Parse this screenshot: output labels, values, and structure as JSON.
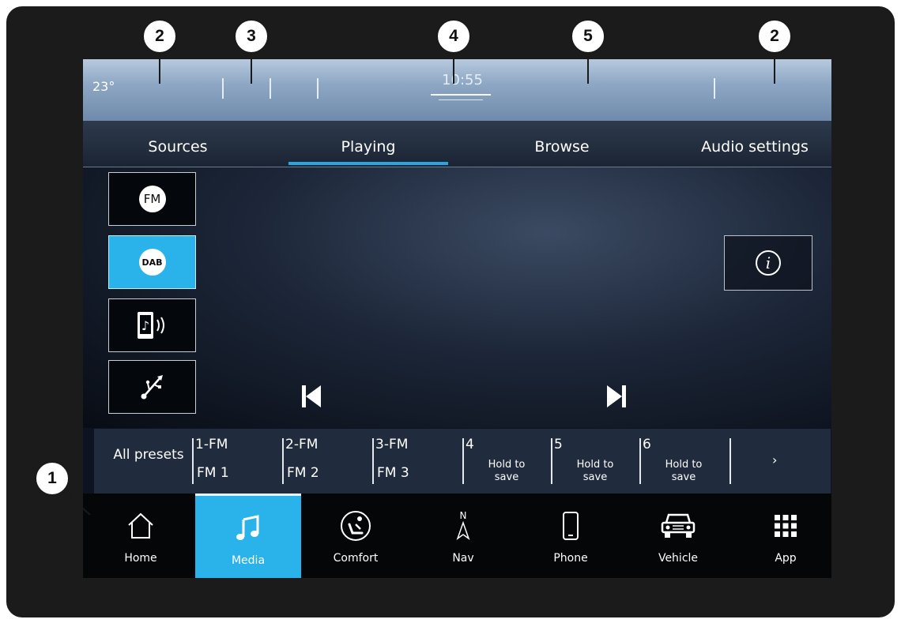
{
  "status": {
    "temperature": "23°",
    "time": "10:55"
  },
  "tabs": [
    "Sources",
    "Playing",
    "Browse",
    "Audio settings"
  ],
  "sources": [
    {
      "label": "FM",
      "icon": "fm-icon"
    },
    {
      "label": "DAB",
      "icon": "dab-icon",
      "active": true
    },
    {
      "icon": "bluetooth-audio-icon"
    },
    {
      "icon": "usb-icon"
    }
  ],
  "presets": {
    "all_label": "All presets",
    "items": [
      {
        "num": "1-FM",
        "name": "FM 1"
      },
      {
        "num": "2-FM",
        "name": "FM 2"
      },
      {
        "num": "3-FM",
        "name": "FM 3"
      },
      {
        "num": "4",
        "hold": "Hold to save"
      },
      {
        "num": "5",
        "hold": "Hold to save"
      },
      {
        "num": "6",
        "hold": "Hold to save"
      }
    ],
    "more": "›"
  },
  "nav": [
    "Home",
    "Media",
    "Comfort",
    "Nav",
    "Phone",
    "Vehicle",
    "App"
  ],
  "nav_compass": "N",
  "callouts": [
    "1",
    "2",
    "3",
    "4",
    "5",
    "2"
  ],
  "colors": {
    "accent": "#2ab2ea",
    "bezel": "#1c1b1b",
    "status_bar": "#8ea7c4"
  }
}
